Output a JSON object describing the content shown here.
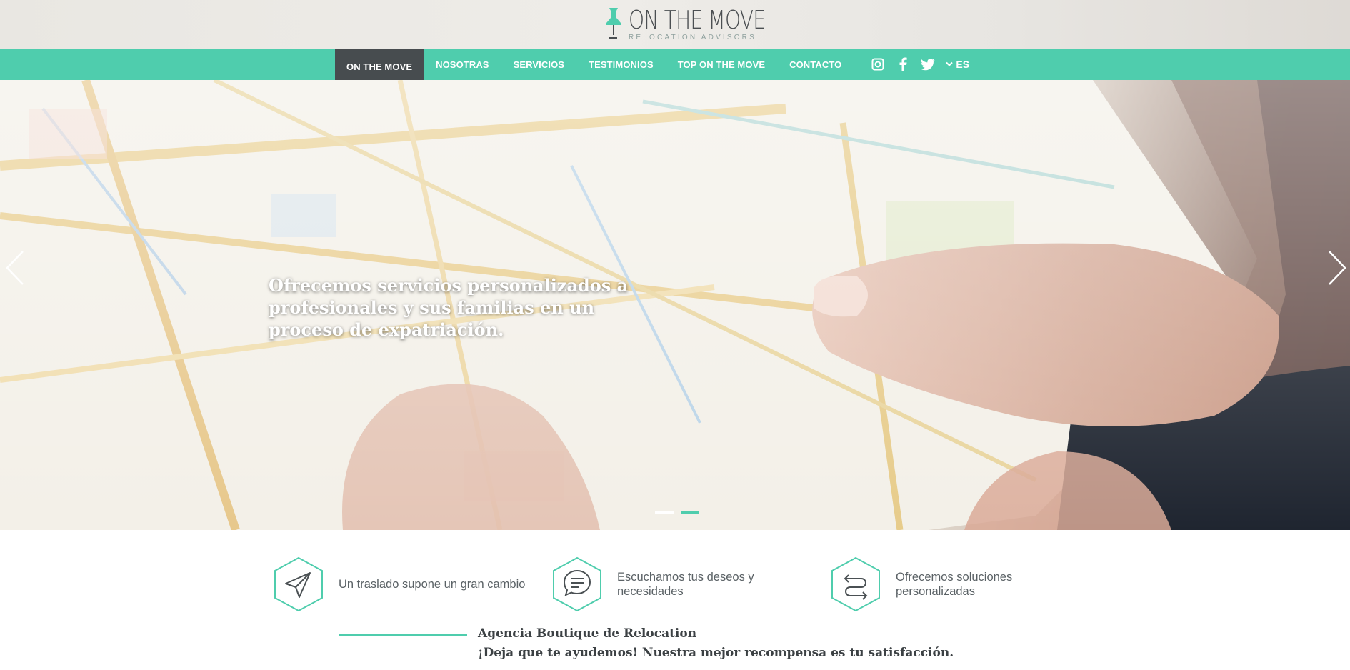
{
  "brand": {
    "title": "ON THE MOVE",
    "subtitle": "RELOCATION ADVISORS",
    "accent": "#4fcdad",
    "dark": "#474c4f"
  },
  "nav": {
    "items": [
      {
        "label": "ON THE MOVE",
        "active": true
      },
      {
        "label": "NOSOTRAS"
      },
      {
        "label": "SERVICIOS"
      },
      {
        "label": "TESTIMONIOS"
      },
      {
        "label": "TOP ON THE MOVE"
      },
      {
        "label": "CONTACTO"
      }
    ],
    "social": [
      "instagram-icon",
      "facebook-icon",
      "twitter-icon"
    ],
    "language": "ES"
  },
  "hero": {
    "text": "Ofrecemos servicios personalizados a profesionales y sus familias en un proceso de expatriación.",
    "slides": 2,
    "active_slide": 2
  },
  "features": [
    {
      "icon": "paper-plane-icon",
      "text": "Un traslado supone un gran cambio"
    },
    {
      "icon": "chat-bubble-icon",
      "text": "Escuchamos tus deseos y necesidades"
    },
    {
      "icon": "swap-arrows-icon",
      "text": "Ofrecemos soluciones personalizadas"
    }
  ],
  "agency": {
    "title": "Agencia Boutique de Relocation",
    "subtitle": "¡Deja que te ayudemos! Nuestra mejor recompensa es tu satisfacción."
  }
}
